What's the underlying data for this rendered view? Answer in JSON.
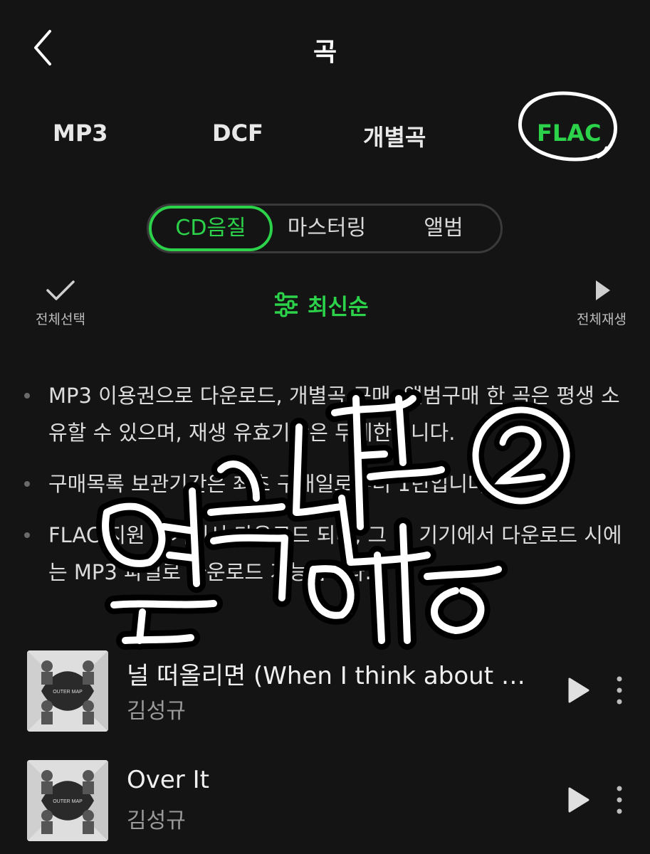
{
  "header": {
    "title": "곡"
  },
  "top_tabs": [
    {
      "label": "MP3"
    },
    {
      "label": "DCF"
    },
    {
      "label": "개별곡"
    },
    {
      "label": "FLAC",
      "active": true
    }
  ],
  "segments": [
    {
      "label": "CD음질",
      "active": true
    },
    {
      "label": "마스터링"
    },
    {
      "label": "앨범"
    }
  ],
  "toolbar": {
    "select_all_label": "전체선택",
    "sort_label": "최신순",
    "play_all_label": "전체재생"
  },
  "notices": [
    "MP3 이용권으로 다운로드, 개별곡 구매, 앨범구매 한 곡은 평생 소유할 수 있으며, 재생 유효기간은 무제한입니다.",
    "구매목록 보관기간은 최초 구매일로부터 1년입니다.",
    "FLAC 지원 기기에서 다운로드 되며, 그 외 기기에서 다운로드 시에는 MP3 파일로 다운로드 가능합니다."
  ],
  "songs": [
    {
      "title": "널 떠올리면 (When I think about you)",
      "artist": "김성규"
    },
    {
      "title": "Over It",
      "artist": "김성규"
    }
  ],
  "album_cover_text": "OUTER MAP",
  "handwriting_text": "멜론 다운 인증②",
  "colors": {
    "accent": "#2bd24a",
    "background": "#141414"
  }
}
